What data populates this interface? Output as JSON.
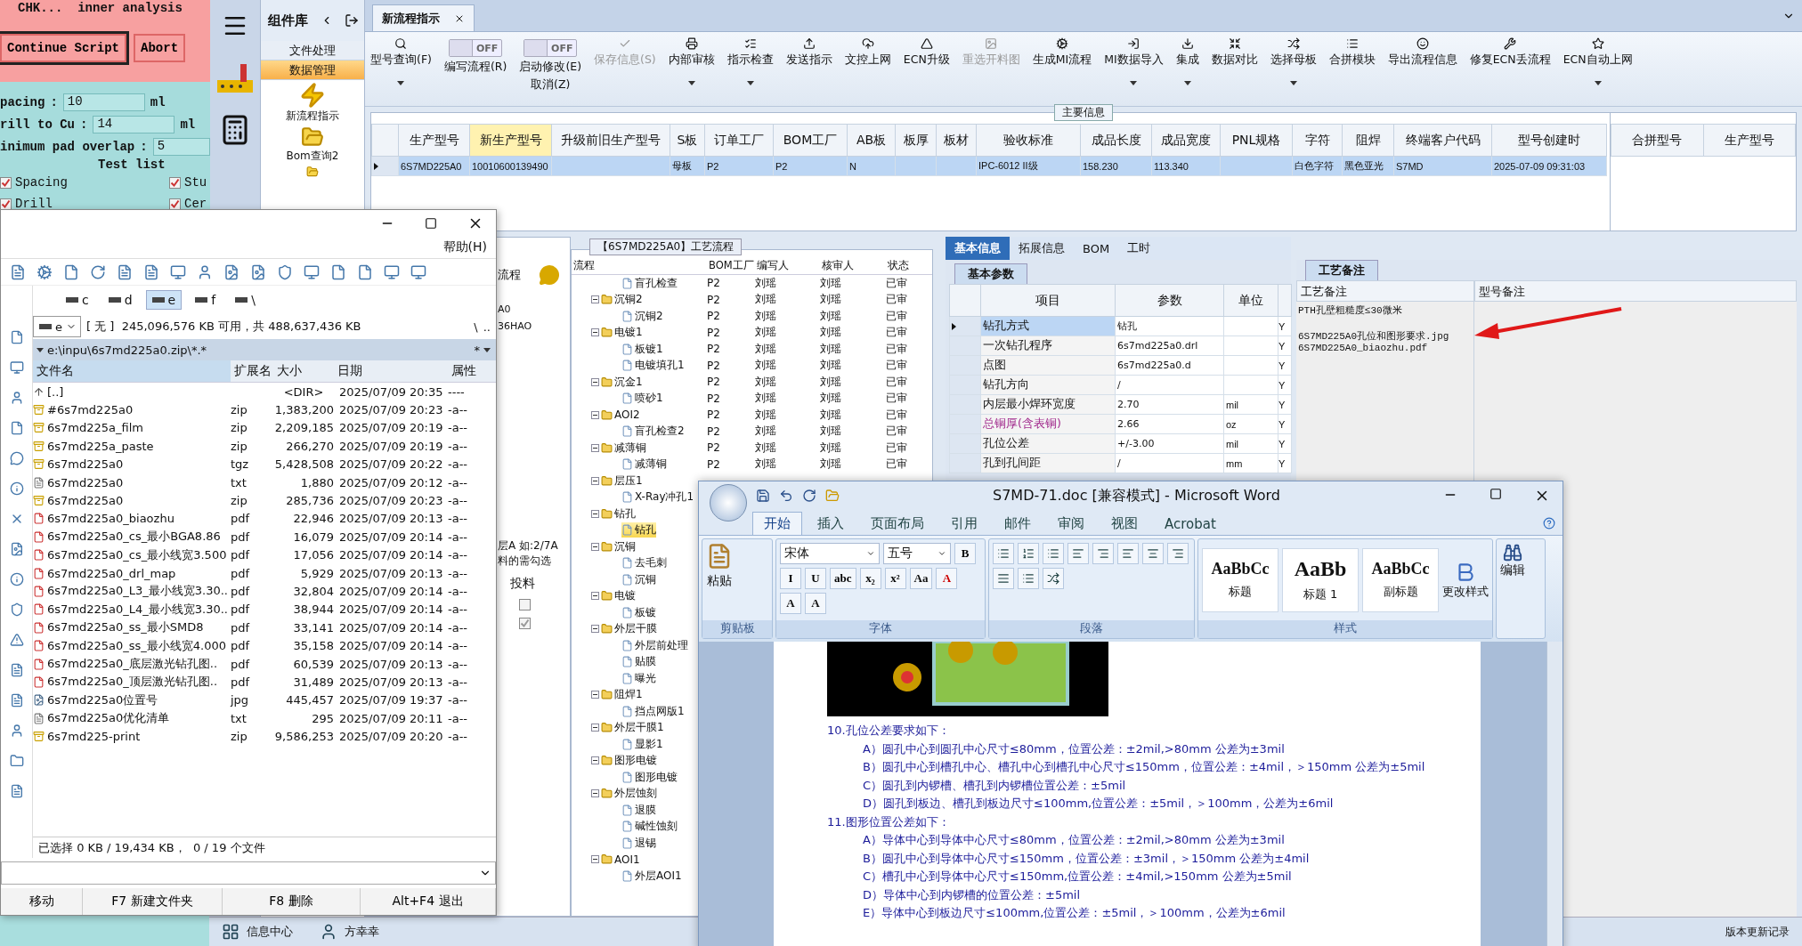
{
  "cam_dialog": {
    "title": "CHK...  inner analysis",
    "buttons": [
      "Continue Script",
      "Abort"
    ],
    "fields": [
      {
        "label": "pacing",
        "separator": ":",
        "value": "10",
        "unit": "ml"
      },
      {
        "label": "rill to Cu",
        "separator": ":",
        "value": "14",
        "unit": "ml"
      },
      {
        "label": "inimum pad overlap",
        "separator": ":",
        "value": "5"
      }
    ],
    "section": "Test list",
    "checks": [
      {
        "label": "Spacing",
        "checked": true
      },
      {
        "label": "Stu",
        "checked": true
      },
      {
        "label": "Drill",
        "checked": true
      },
      {
        "label": "Cer",
        "checked": true
      }
    ]
  },
  "app": {
    "nav_panel": {
      "title": "组件库",
      "groups": [
        {
          "label": "文件处理",
          "selected": false
        },
        {
          "label": "数据管理",
          "selected": true
        }
      ],
      "items": [
        {
          "kind": "bolt",
          "label": "新流程指示"
        },
        {
          "kind": "folder",
          "label": "Bom查询2"
        },
        {
          "kind": "folder"
        }
      ]
    },
    "tabs": [
      {
        "label": "新流程指示",
        "selected": true
      }
    ],
    "toolbar": [
      {
        "kind": "button",
        "label": "型号查询(F)",
        "dropdown": true,
        "disabled": false
      },
      {
        "kind": "toggle",
        "label": "编写流程(R)",
        "state": "OFF",
        "on": false
      },
      {
        "kind": "toggle",
        "label": "启动修改(E)",
        "sublabel": "取消(Z)",
        "state": "OFF",
        "on": false
      },
      {
        "kind": "button",
        "label": "保存信息(S)",
        "dropdown": false,
        "disabled": true
      },
      {
        "kind": "button",
        "label": "内部审核",
        "dropdown": true,
        "disabled": false
      },
      {
        "kind": "button",
        "label": "指示检查",
        "dropdown": true,
        "disabled": false
      },
      {
        "kind": "button",
        "label": "发送指示",
        "dropdown": false,
        "disabled": false
      },
      {
        "kind": "button",
        "label": "文控上网",
        "dropdown": false,
        "disabled": false
      },
      {
        "kind": "button",
        "label": "ECN升级",
        "dropdown": false,
        "disabled": false
      },
      {
        "kind": "button",
        "label": "重选开料图",
        "dropdown": false,
        "disabled": true
      },
      {
        "kind": "button",
        "label": "生成MI流程",
        "dropdown": false,
        "disabled": false
      },
      {
        "kind": "button",
        "label": "MI数据导入",
        "dropdown": true,
        "disabled": false
      },
      {
        "kind": "button",
        "label": "集成",
        "dropdown": true,
        "disabled": false
      },
      {
        "kind": "button",
        "label": "数据对比",
        "dropdown": false,
        "disabled": false
      },
      {
        "kind": "button",
        "label": "选择母板",
        "dropdown": true,
        "disabled": false
      },
      {
        "kind": "button",
        "label": "合拼模块",
        "dropdown": false,
        "disabled": false
      },
      {
        "kind": "button",
        "label": "导出流程信息",
        "dropdown": false,
        "disabled": false
      },
      {
        "kind": "button",
        "label": "修复ECN丢流程",
        "dropdown": false,
        "disabled": false
      },
      {
        "kind": "button",
        "label": "ECN自动上网",
        "dropdown": true,
        "disabled": false
      }
    ],
    "main_info": {
      "title": "主要信息",
      "columns": [
        {
          "label": "生产型号",
          "highlighted": false
        },
        {
          "label": "新生产型号",
          "highlighted": true
        },
        {
          "label": "升级前旧生产型号",
          "highlighted": false
        },
        {
          "label": "S板",
          "highlighted": false
        },
        {
          "label": "订单工厂",
          "highlighted": false
        },
        {
          "label": "BOM工厂",
          "highlighted": false
        },
        {
          "label": "AB板",
          "highlighted": false
        },
        {
          "label": "板厚",
          "highlighted": false
        },
        {
          "label": "板材",
          "highlighted": false
        },
        {
          "label": "验收标准",
          "highlighted": false
        },
        {
          "label": "成品长度",
          "highlighted": false
        },
        {
          "label": "成品宽度",
          "highlighted": false
        },
        {
          "label": "PNL规格",
          "highlighted": false
        },
        {
          "label": "字符",
          "highlighted": false
        },
        {
          "label": "阻焊",
          "highlighted": false
        },
        {
          "label": "终端客户代码",
          "highlighted": false
        },
        {
          "label": "型号创建时",
          "highlighted": false
        }
      ],
      "rows": [
        {
          "selected": true,
          "cells": [
            "6S7MD225A0",
            "10010600139490",
            "",
            "母板",
            "P2",
            "P2",
            "N",
            "",
            "",
            "IPC-6012 II级",
            "158.230",
            "113.340",
            "",
            "白色字符",
            "黑色亚光",
            "S7MD",
            "2025-07-09 09:31:03"
          ]
        }
      ],
      "side_columns": [
        "合拼型号",
        "生产型号"
      ]
    },
    "side_panel": {
      "title": "流程",
      "lines": [
        "A0",
        "36HAO"
      ],
      "notes": [
        "层A 如:2/7A",
        "料的需勾选"
      ],
      "column": "投料",
      "rows": [
        {
          "checked": false
        },
        {
          "checked": true
        }
      ]
    },
    "process_flow": {
      "title": "【6S7MD225A0】工艺流程",
      "columns": [
        "流程",
        "BOM工厂",
        "编写人",
        "核审人",
        "状态"
      ],
      "nodes": [
        {
          "kind": "step",
          "label": "盲孔检查",
          "bom": "P2",
          "writer": "刘瑶",
          "reviewer": "刘瑶",
          "status": "已审",
          "selected": false
        },
        {
          "kind": "group",
          "label": "沉铜2",
          "bom": "P2",
          "writer": "刘瑶",
          "reviewer": "刘瑶",
          "status": "已审",
          "expanded": true,
          "selected": false,
          "children": [
            {
              "kind": "step",
              "label": "沉铜2",
              "bom": "P2",
              "writer": "刘瑶",
              "reviewer": "刘瑶",
              "status": "已审",
              "selected": false
            }
          ]
        },
        {
          "kind": "group",
          "label": "电镀1",
          "bom": "P2",
          "writer": "刘瑶",
          "reviewer": "刘瑶",
          "status": "已审",
          "expanded": true,
          "selected": false,
          "children": [
            {
              "kind": "step",
              "label": "板镀1",
              "bom": "P2",
              "writer": "刘瑶",
              "reviewer": "刘瑶",
              "status": "已审",
              "selected": false
            },
            {
              "kind": "step",
              "label": "电镀填孔1",
              "bom": "P2",
              "writer": "刘瑶",
              "reviewer": "刘瑶",
              "status": "已审",
              "selected": false
            }
          ]
        },
        {
          "kind": "group",
          "label": "沉金1",
          "bom": "P2",
          "writer": "刘瑶",
          "reviewer": "刘瑶",
          "status": "已审",
          "expanded": true,
          "selected": false,
          "children": [
            {
              "kind": "step",
              "label": "喷砂1",
              "bom": "P2",
              "writer": "刘瑶",
              "reviewer": "刘瑶",
              "status": "已审",
              "selected": false
            }
          ]
        },
        {
          "kind": "group",
          "label": "AOI2",
          "bom": "P2",
          "writer": "刘瑶",
          "reviewer": "刘瑶",
          "status": "已审",
          "expanded": true,
          "selected": false,
          "children": [
            {
              "kind": "step",
              "label": "盲孔检查2",
              "bom": "P2",
              "writer": "刘瑶",
              "reviewer": "刘瑶",
              "status": "已审",
              "selected": false
            }
          ]
        },
        {
          "kind": "group",
          "label": "减薄铜",
          "bom": "P2",
          "writer": "刘瑶",
          "reviewer": "刘瑶",
          "status": "已审",
          "expanded": true,
          "selected": false,
          "children": [
            {
              "kind": "step",
              "label": "减薄铜",
              "bom": "P2",
              "writer": "刘瑶",
              "reviewer": "刘瑶",
              "status": "已审",
              "selected": false
            }
          ]
        },
        {
          "kind": "group",
          "label": "层压1",
          "expanded": true,
          "selected": false,
          "children": [
            {
              "kind": "step",
              "label": "X-Ray冲孔1",
              "selected": false
            }
          ]
        },
        {
          "kind": "group",
          "label": "钻孔",
          "expanded": true,
          "selected": false,
          "children": [
            {
              "kind": "step",
              "label": "钻孔",
              "selected": true
            }
          ]
        },
        {
          "kind": "group",
          "label": "沉铜",
          "expanded": true,
          "selected": false,
          "children": [
            {
              "kind": "step",
              "label": "去毛刺",
              "selected": false
            },
            {
              "kind": "step",
              "label": "沉铜",
              "selected": false
            }
          ]
        },
        {
          "kind": "group",
          "label": "电镀",
          "expanded": true,
          "selected": false,
          "children": [
            {
              "kind": "step",
              "label": "板镀",
              "selected": false
            }
          ]
        },
        {
          "kind": "group",
          "label": "外层干膜",
          "expanded": true,
          "selected": false,
          "children": [
            {
              "kind": "step",
              "label": "外层前处理",
              "selected": false
            },
            {
              "kind": "step",
              "label": "贴膜",
              "selected": false
            },
            {
              "kind": "step",
              "label": "曝光",
              "selected": false
            }
          ]
        },
        {
          "kind": "group",
          "label": "阻焊1",
          "expanded": true,
          "selected": false,
          "children": [
            {
              "kind": "step",
              "label": "挡点网版1",
              "selected": false
            }
          ]
        },
        {
          "kind": "group",
          "label": "外层干膜1",
          "expanded": true,
          "selected": false,
          "children": [
            {
              "kind": "step",
              "label": "显影1",
              "selected": false
            }
          ]
        },
        {
          "kind": "group",
          "label": "图形电镀",
          "expanded": true,
          "selected": false,
          "children": [
            {
              "kind": "step",
              "label": "图形电镀",
              "selected": false
            }
          ]
        },
        {
          "kind": "group",
          "label": "外层蚀刻",
          "expanded": true,
          "selected": false,
          "children": [
            {
              "kind": "step",
              "label": "退膜",
              "selected": false
            },
            {
              "kind": "step",
              "label": "碱性蚀刻",
              "selected": false
            },
            {
              "kind": "step",
              "label": "退锡",
              "selected": false
            }
          ]
        },
        {
          "kind": "group",
          "label": "AOI1",
          "expanded": true,
          "selected": false,
          "children": [
            {
              "kind": "step",
              "label": "外层AOI1",
              "selected": false
            }
          ]
        }
      ]
    },
    "basic_info": {
      "tabs": [
        {
          "label": "基本信息",
          "selected": true
        },
        {
          "label": "拓展信息",
          "selected": false
        },
        {
          "label": "BOM",
          "selected": false
        },
        {
          "label": "工时",
          "selected": false
        }
      ],
      "subtab": "基本参数",
      "columns": [
        "项目",
        "参数",
        "单位"
      ],
      "rows": [
        {
          "kind": "normal",
          "item": "钻孔方式",
          "value": "钻孔",
          "unit": "",
          "column_4": "Y",
          "selected": true
        },
        {
          "kind": "normal",
          "item": "一次钻孔程序",
          "value": "6s7md225a0.drl",
          "unit": "",
          "column_4": "Y",
          "selected": false
        },
        {
          "kind": "normal",
          "item": "点图",
          "value": "6s7md225a0.d",
          "unit": "",
          "column_4": "Y",
          "selected": false
        },
        {
          "kind": "normal",
          "item": "钻孔方向",
          "value": "/",
          "unit": "",
          "column_4": "Y",
          "selected": false
        },
        {
          "kind": "normal",
          "item": "内层最小焊环宽度",
          "value": "2.70",
          "unit": "mil",
          "column_4": "Y",
          "selected": false
        },
        {
          "kind": "emphasis",
          "item": "总铜厚(含表铜)",
          "value": "2.66",
          "unit": "oz",
          "column_4": "Y",
          "selected": false
        },
        {
          "kind": "normal",
          "item": "孔位公差",
          "value": "+/-3.00",
          "unit": "mil",
          "column_4": "Y",
          "selected": false
        },
        {
          "kind": "normal",
          "item": "孔到孔间距",
          "value": "/",
          "unit": "mm",
          "column_4": "Y",
          "selected": false
        }
      ]
    },
    "notes": {
      "tab": "工艺备注",
      "columns": [
        "工艺备注",
        "型号备注"
      ],
      "lines": [
        "PTH孔壁粗糙度≤30微米",
        "6S7MD225A0孔位和图形要求.jpg",
        "6S7MD225A0_biaozhu.pdf"
      ]
    },
    "taskbar": [
      {
        "label": "信息中心"
      },
      {
        "label": "方幸幸"
      }
    ],
    "version_link": "版本更新记录"
  },
  "file_manager": {
    "menu": "帮助(H)",
    "drives": [
      {
        "label": "c",
        "selected": false
      },
      {
        "label": "d",
        "selected": false
      },
      {
        "label": "e",
        "selected": true
      },
      {
        "label": "f",
        "selected": false
      },
      {
        "label": "\\",
        "selected": false
      }
    ],
    "drive_combo": "e",
    "free_space": "[ 无 ]  245,096,576 KB 可用，共 488,637,436 KB",
    "root_button": "\\",
    "up_button": "..",
    "path": "e:\\inpu\\6s7md225a0.zip\\*.*",
    "filter": "*",
    "columns": [
      "文件名",
      "扩展名",
      "大小",
      "日期",
      "属性"
    ],
    "rows": [
      {
        "kind": "parent",
        "name": "[..]",
        "ext": "",
        "size": "<DIR>",
        "date": "2025/07/09 20:35",
        "attr": "----"
      },
      {
        "kind": "archive",
        "name": "#6s7md225a0",
        "ext": "zip",
        "size": "1,383,200",
        "date": "2025/07/09 20:23",
        "attr": "-a--"
      },
      {
        "kind": "archive",
        "name": "6s7md225a_film",
        "ext": "zip",
        "size": "2,209,185",
        "date": "2025/07/09 20:19",
        "attr": "-a--"
      },
      {
        "kind": "archive",
        "name": "6s7md225a_paste",
        "ext": "zip",
        "size": "266,270",
        "date": "2025/07/09 20:19",
        "attr": "-a--"
      },
      {
        "kind": "archive",
        "name": "6s7md225a0",
        "ext": "tgz",
        "size": "5,428,508",
        "date": "2025/07/09 20:22",
        "attr": "-a--"
      },
      {
        "kind": "text",
        "name": "6s7md225a0",
        "ext": "txt",
        "size": "1,880",
        "date": "2025/07/09 20:12",
        "attr": "-a--"
      },
      {
        "kind": "archive",
        "name": "6s7md225a0",
        "ext": "zip",
        "size": "285,736",
        "date": "2025/07/09 20:23",
        "attr": "-a--"
      },
      {
        "kind": "pdf",
        "name": "6s7md225a0_biaozhu",
        "ext": "pdf",
        "size": "22,946",
        "date": "2025/07/09 20:13",
        "attr": "-a--"
      },
      {
        "kind": "pdf",
        "name": "6s7md225a0_cs_最小BGA8.86",
        "ext": "pdf",
        "size": "16,079",
        "date": "2025/07/09 20:14",
        "attr": "-a--"
      },
      {
        "kind": "pdf",
        "name": "6s7md225a0_cs_最小线宽3.500",
        "ext": "pdf",
        "size": "17,056",
        "date": "2025/07/09 20:14",
        "attr": "-a--"
      },
      {
        "kind": "pdf",
        "name": "6s7md225a0_drl_map",
        "ext": "pdf",
        "size": "5,929",
        "date": "2025/07/09 20:13",
        "attr": "-a--"
      },
      {
        "kind": "pdf",
        "name": "6s7md225a0_L3_最小线宽3.30..",
        "ext": "pdf",
        "size": "32,804",
        "date": "2025/07/09 20:14",
        "attr": "-a--"
      },
      {
        "kind": "pdf",
        "name": "6s7md225a0_L4_最小线宽3.30..",
        "ext": "pdf",
        "size": "38,944",
        "date": "2025/07/09 20:14",
        "attr": "-a--"
      },
      {
        "kind": "pdf",
        "name": "6s7md225a0_ss_最小SMD8",
        "ext": "pdf",
        "size": "33,141",
        "date": "2025/07/09 20:14",
        "attr": "-a--"
      },
      {
        "kind": "pdf",
        "name": "6s7md225a0_ss_最小线宽4.000",
        "ext": "pdf",
        "size": "35,158",
        "date": "2025/07/09 20:14",
        "attr": "-a--"
      },
      {
        "kind": "pdf",
        "name": "6s7md225a0_底层激光钻孔图..",
        "ext": "pdf",
        "size": "60,539",
        "date": "2025/07/09 20:13",
        "attr": "-a--"
      },
      {
        "kind": "pdf",
        "name": "6s7md225a0_顶层激光钻孔图..",
        "ext": "pdf",
        "size": "31,489",
        "date": "2025/07/09 20:13",
        "attr": "-a--"
      },
      {
        "kind": "image",
        "name": "6s7md225a0位置号",
        "ext": "jpg",
        "size": "445,457",
        "date": "2025/07/09 19:37",
        "attr": "-a--"
      },
      {
        "kind": "text",
        "name": "6s7md225a0优化清单",
        "ext": "txt",
        "size": "295",
        "date": "2025/07/09 20:11",
        "attr": "-a--"
      },
      {
        "kind": "archive",
        "name": "6s7md225-print",
        "ext": "zip",
        "size": "9,586,253",
        "date": "2025/07/09 20:20",
        "attr": "-a--"
      }
    ],
    "status": "已选择 0 KB / 19,434 KB，  0 / 19 个文件",
    "function_keys": [
      "移动",
      "F7 新建文件夹",
      "F8 删除",
      "Alt+F4 退出"
    ]
  },
  "word": {
    "title": "S7MD-71.doc [兼容模式] - Microsoft Word",
    "tabs": [
      {
        "label": "开始",
        "selected": true
      },
      {
        "label": "插入",
        "selected": false
      },
      {
        "label": "页面布局",
        "selected": false
      },
      {
        "label": "引用",
        "selected": false
      },
      {
        "label": "邮件",
        "selected": false
      },
      {
        "label": "审阅",
        "selected": false
      },
      {
        "label": "视图",
        "selected": false
      },
      {
        "label": "Acrobat",
        "selected": false
      }
    ],
    "clipboard": {
      "label": "剪贴板",
      "paste": "粘贴"
    },
    "font": {
      "label": "字体",
      "name": "宋体",
      "size": "五号",
      "buttons": [
        "B",
        "I",
        "U",
        "abc",
        "x₂",
        "x²"
      ],
      "buttons_2": [
        "Aa",
        "A",
        "A",
        "A"
      ]
    },
    "paragraph": {
      "label": "段落"
    },
    "styles": {
      "label": "样式",
      "items": [
        {
          "sample": "AaBbCc",
          "label": "标题"
        },
        {
          "sample": "AaBb",
          "label": "标题 1"
        },
        {
          "sample": "AaBbCc",
          "label": "副标题"
        }
      ],
      "change": "更改样式"
    },
    "editing": "编辑",
    "document": [
      {
        "kind": "heading",
        "text": "10.孔位公差要求如下："
      },
      {
        "kind": "item",
        "text": "A）圆孔中心到圆孔中心尺寸≤80mm，位置公差：±2mil,>80mm 公差为±3mil"
      },
      {
        "kind": "item",
        "text": "B）圆孔中心到槽孔中心、槽孔中心到槽孔中心尺寸≤150mm，位置公差：±4mil，＞150mm 公差为±5mil"
      },
      {
        "kind": "item",
        "text": "C）圆孔到内锣槽、槽孔到内锣槽位置公差：±5mil"
      },
      {
        "kind": "item",
        "text": "D）圆孔到板边、槽孔到板边尺寸≤100mm,位置公差：±5mil，＞100mm，公差为±6mil"
      },
      {
        "kind": "heading",
        "text": "11.图形位置公差如下："
      },
      {
        "kind": "item",
        "text": "A）导体中心到导体中心尺寸≤80mm，位置公差：±2mil,>80mm 公差为±3mil"
      },
      {
        "kind": "item",
        "text": "B）圆孔中心到导体中心尺寸≤150mm，位置公差：±3mil，＞150mm 公差为±4mil"
      },
      {
        "kind": "item",
        "text": "C）槽孔中心到导体中心尺寸≤150mm,位置公差：±4mil,>150mm 公差为±5mil"
      },
      {
        "kind": "item",
        "text": "D）导体中心到内锣槽的位置公差：±5mil"
      },
      {
        "kind": "item",
        "text": "E）导体中心到板边尺寸≤100mm,位置公差：±5mil，＞100mm，公差为±6mil"
      }
    ]
  }
}
